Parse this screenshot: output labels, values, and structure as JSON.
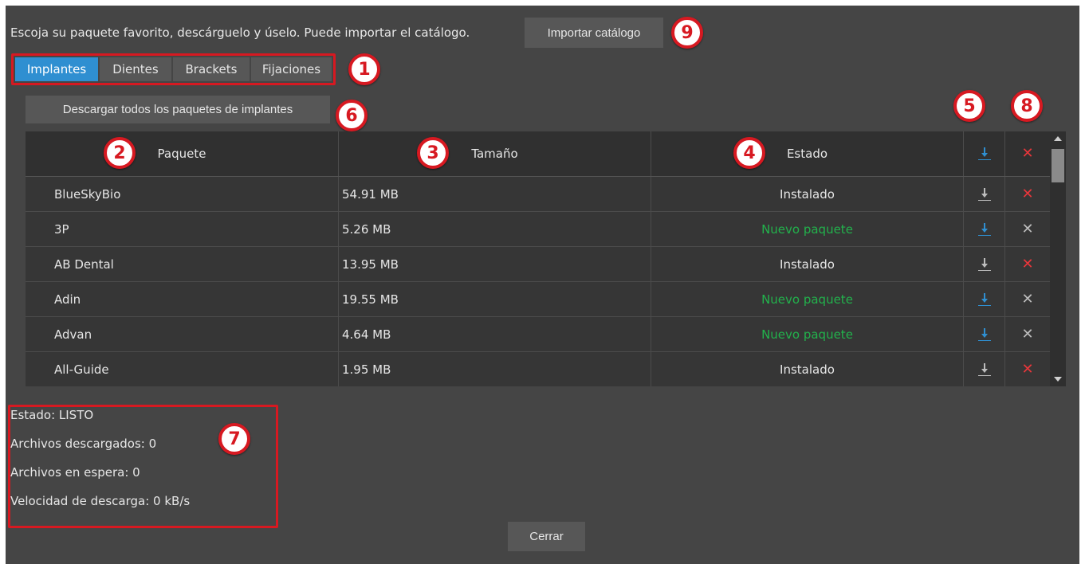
{
  "intro_text": "Escoja su paquete favorito, descárguelo y úselo. Puede importar el catálogo.",
  "import_button": "Importar catálogo",
  "tabs": [
    {
      "label": "Implantes",
      "active": true
    },
    {
      "label": "Dientes",
      "active": false
    },
    {
      "label": "Brackets",
      "active": false
    },
    {
      "label": "Fijaciones",
      "active": false
    }
  ],
  "download_all_button": "Descargar todos los paquetes de implantes",
  "table": {
    "headers": {
      "package": "Paquete",
      "size": "Tamaño",
      "state": "Estado"
    },
    "header_icons": {
      "download": "download-icon",
      "delete": "close-icon"
    },
    "rows": [
      {
        "name": "BlueSkyBio",
        "size": "54.91 MB",
        "state": "Instalado",
        "state_type": "installed"
      },
      {
        "name": "3P",
        "size": "5.26 MB",
        "state": "Nuevo paquete",
        "state_type": "new"
      },
      {
        "name": "AB Dental",
        "size": "13.95 MB",
        "state": "Instalado",
        "state_type": "installed"
      },
      {
        "name": "Adin",
        "size": "19.55 MB",
        "state": "Nuevo paquete",
        "state_type": "new"
      },
      {
        "name": "Advan",
        "size": "4.64 MB",
        "state": "Nuevo paquete",
        "state_type": "new"
      },
      {
        "name": "All-Guide",
        "size": "1.95 MB",
        "state": "Instalado",
        "state_type": "installed"
      }
    ]
  },
  "status": {
    "estado": "Estado:  LISTO",
    "descargados": "Archivos descargados:  0",
    "espera": "Archivos en espera:  0",
    "velocidad": "Velocidad de descarga:  0 kB/s"
  },
  "close_button": "Cerrar",
  "callouts": [
    "1",
    "2",
    "3",
    "4",
    "5",
    "6",
    "7",
    "8",
    "9"
  ],
  "colors": {
    "accent_blue": "#2f8fd1",
    "new_package_green": "#22b24c",
    "delete_red": "#e8363b",
    "callout_red": "#d71921"
  }
}
